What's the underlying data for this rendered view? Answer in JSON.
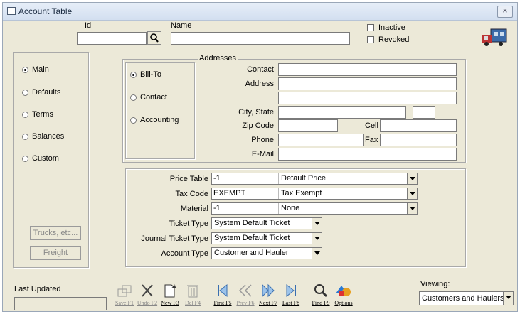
{
  "window": {
    "title": "Account Table",
    "close_label": "⨯"
  },
  "header": {
    "id_label": "Id",
    "id_value": "",
    "name_label": "Name",
    "name_value": "",
    "inactive_label": "Inactive",
    "revoked_label": "Revoked"
  },
  "nav": {
    "items": [
      {
        "label": "Main",
        "selected": true
      },
      {
        "label": "Defaults",
        "selected": false
      },
      {
        "label": "Terms",
        "selected": false
      },
      {
        "label": "Balances",
        "selected": false
      },
      {
        "label": "Custom",
        "selected": false
      }
    ],
    "trucks_button": "Trucks, etc...",
    "freight_button": "Freight"
  },
  "address_types": [
    {
      "label": "Bill-To",
      "selected": true
    },
    {
      "label": "Contact",
      "selected": false
    },
    {
      "label": "Accounting",
      "selected": false
    }
  ],
  "addresses": {
    "group_label": "Addresses",
    "contact_label": "Contact",
    "address_label": "Address",
    "city_state_label": "City, State",
    "zip_label": "Zip Code",
    "cell_label": "Cell",
    "phone_label": "Phone",
    "fax_label": "Fax",
    "email_label": "E-Mail"
  },
  "settings": {
    "price_table": {
      "label": "Price Table",
      "code": "-1",
      "desc": "Default Price"
    },
    "tax_code": {
      "label": "Tax Code",
      "code": "EXEMPT",
      "desc": "Tax Exempt"
    },
    "material": {
      "label": "Material",
      "code": "-1",
      "desc": "None"
    },
    "ticket_type": {
      "label": "Ticket Type",
      "value": "System Default Ticket"
    },
    "journal_ticket_type": {
      "label": "Journal Ticket Type",
      "value": "System Default Ticket"
    },
    "account_type": {
      "label": "Account Type",
      "value": "Customer and Hauler"
    }
  },
  "footer": {
    "last_updated_label": "Last Updated",
    "last_updated_value": "",
    "viewing_label": "Viewing:",
    "viewing_value": "Customers and Haulers"
  },
  "toolbar": [
    {
      "label": "Save F1",
      "icon": "save-icon",
      "enabled": false
    },
    {
      "label": "Undo F2",
      "icon": "undo-icon",
      "enabled": false
    },
    {
      "label": "New F3",
      "icon": "new-icon",
      "enabled": true
    },
    {
      "label": "Del F4",
      "icon": "delete-icon",
      "enabled": false
    },
    {
      "label": "First F5",
      "icon": "first-icon",
      "enabled": true
    },
    {
      "label": "Prev F6",
      "icon": "prev-icon",
      "enabled": false
    },
    {
      "label": "Next F7",
      "icon": "next-icon",
      "enabled": true
    },
    {
      "label": "Last F8",
      "icon": "last-icon",
      "enabled": true
    },
    {
      "label": "Find F9",
      "icon": "find-icon",
      "enabled": true
    },
    {
      "label": "Options",
      "icon": "options-icon",
      "enabled": true
    }
  ]
}
